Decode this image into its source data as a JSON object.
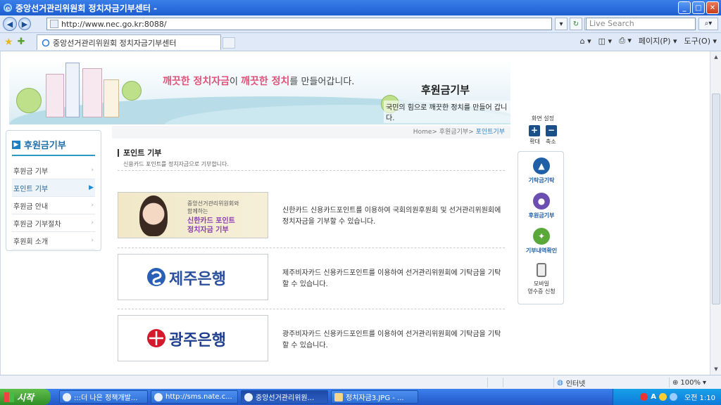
{
  "window": {
    "title": "중앙선거관리위원회 정치자금기부센터 -"
  },
  "nav": {
    "address": "http://www.nec.go.kr:8088/",
    "search_placeholder": "Live Search"
  },
  "tabs": [
    {
      "label": "중앙선거관리위원회 정치자금기부센터"
    }
  ],
  "command_bar": {
    "page_label": "페이지(P) ▾",
    "tools_label": "도구(O) ▾"
  },
  "banner": {
    "slogan_part1": "깨끗한 정치자금",
    "slogan_mid": "이 ",
    "slogan_part2": "깨끗한 정치",
    "slogan_end": "를 만들어갑니다.",
    "title": "후원금기부",
    "subtitle": "국민의 힘으로 깨끗한 정치를 만들어 갑니다."
  },
  "sidebar": {
    "title": "후원금기부",
    "items": [
      {
        "label": "후원금 기부",
        "active": false
      },
      {
        "label": "포인트 기부",
        "active": true
      },
      {
        "label": "후원금 안내",
        "active": false
      },
      {
        "label": "후원금 기부절차",
        "active": false
      },
      {
        "label": "후원회 소개",
        "active": false
      }
    ]
  },
  "breadcrumb": {
    "home": "Home",
    "level1": "후원금기부",
    "current": "포인트기부"
  },
  "page": {
    "title": "포인트 기부",
    "description": "신용카드 포인트를 정치자금으로 기부합니다."
  },
  "cards": [
    {
      "line1": "중앙선거관리위원회와",
      "line2": "함께하는",
      "highlight1": "신한카드 포인트",
      "highlight2": "정치자금 기부",
      "text": "신한카드 신용카드포인트를 이용하여 국회의원후원회 및 선거관리위원회에 정치자금을 기부할 수 있습니다."
    },
    {
      "bank": "제주은행",
      "color": "#2a4f9c",
      "text": "제주비자카드 신용카드포인트를 이용하여 선거관리위원회에 기탁금을 기탁할 수 있습니다."
    },
    {
      "bank": "광주은행",
      "color": "#1f3f8f",
      "logo_color": "#d6182c",
      "text": "광주비자카드 신용카드포인트를 이용하여 선거관리위원회에 기탁금을 기탁할 수 있습니다."
    }
  ],
  "quick": {
    "zoom_title": "화면 설정",
    "zoom_in": "확대",
    "zoom_out": "축소",
    "items": [
      {
        "label": "기탁금기탁",
        "icon": "ballot-icon",
        "color": "#1e5fa8"
      },
      {
        "label": "후원금기부",
        "icon": "people-icon",
        "color": "#6a4fb0"
      },
      {
        "label": "기부내역확인",
        "icon": "bulb-icon",
        "color": "#5aa83a"
      },
      {
        "label_line1": "모바일",
        "label_line2": "영수증 신청",
        "icon": "mobile-phone-icon"
      }
    ]
  },
  "status": {
    "zone": "인터넷",
    "zoom": "100%"
  },
  "taskbar": {
    "start": "시작",
    "tasks": [
      {
        "label": ":::더 나은 정책개발..."
      },
      {
        "label": "http://sms.nate.c..."
      },
      {
        "label": "중앙선거관리위원..."
      },
      {
        "label": "정치자금3.JPG - ..."
      }
    ],
    "clock": "오전 1:10"
  }
}
